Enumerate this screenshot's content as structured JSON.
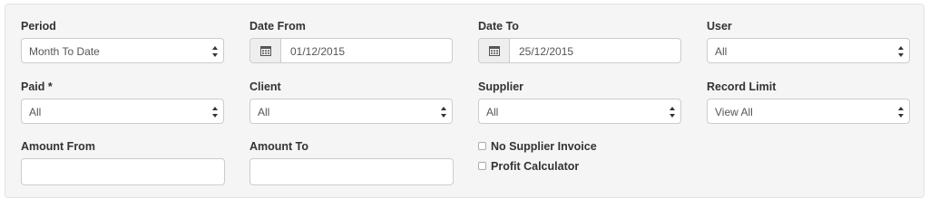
{
  "filters": {
    "period": {
      "label": "Period",
      "value": "Month To Date"
    },
    "date_from": {
      "label": "Date From",
      "value": "01/12/2015"
    },
    "date_to": {
      "label": "Date To",
      "value": "25/12/2015"
    },
    "user": {
      "label": "User",
      "value": "All"
    },
    "paid": {
      "label": "Paid *",
      "value": "All"
    },
    "client": {
      "label": "Client",
      "value": "All"
    },
    "supplier": {
      "label": "Supplier",
      "value": "All"
    },
    "record_limit": {
      "label": "Record Limit",
      "value": "View All"
    },
    "amount_from": {
      "label": "Amount From",
      "value": ""
    },
    "amount_to": {
      "label": "Amount To",
      "value": ""
    },
    "no_supplier_invoice": {
      "label": "No Supplier Invoice",
      "checked": false
    },
    "profit_calculator": {
      "label": "Profit Calculator",
      "checked": false
    }
  },
  "icons": {
    "date": "calendar-icon",
    "select": "up-down-arrows-icon"
  }
}
